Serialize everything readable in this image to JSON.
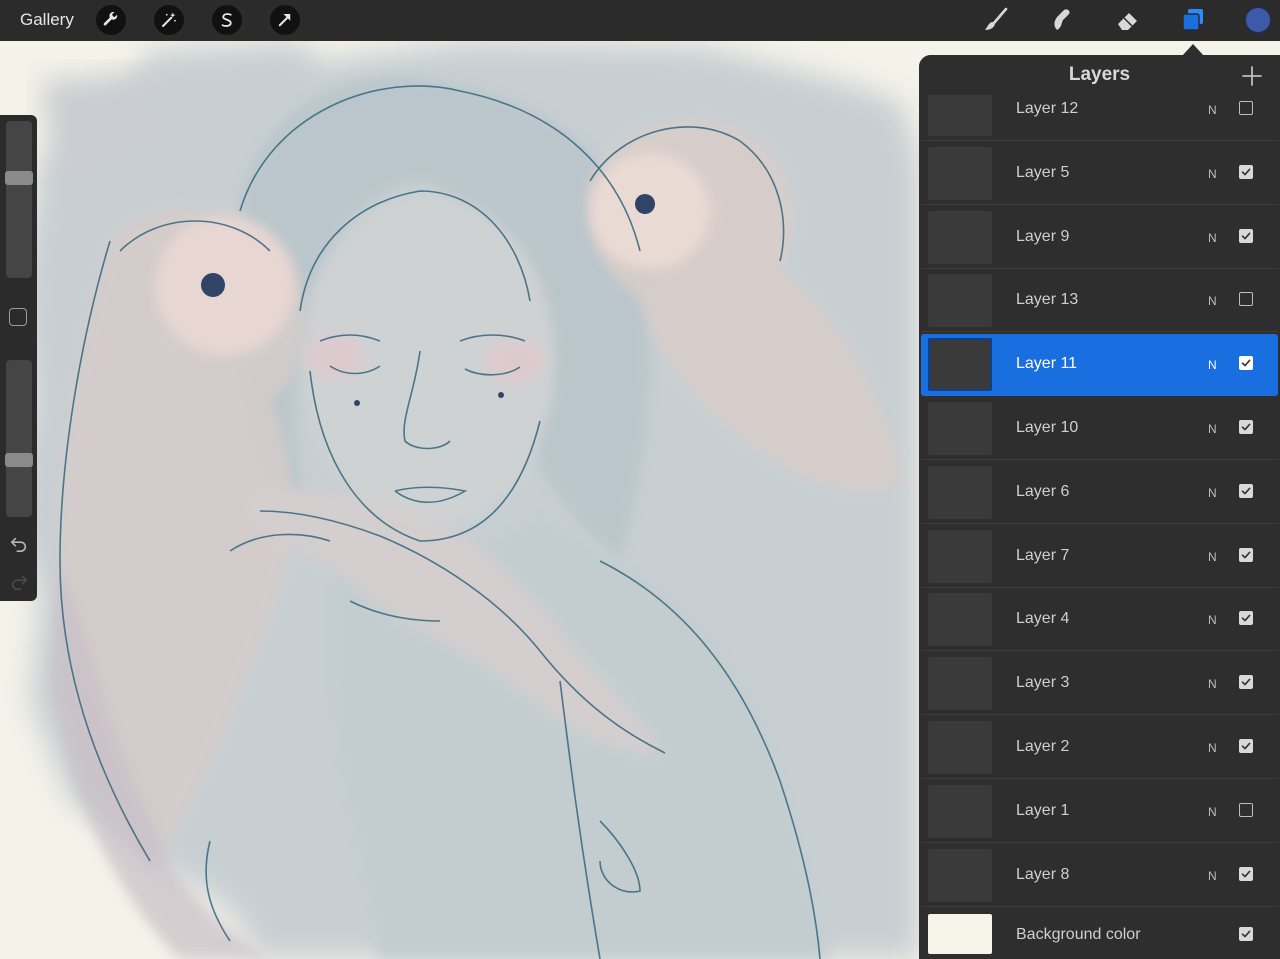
{
  "topbar": {
    "gallery_label": "Gallery",
    "left_tools": [
      {
        "icon": "wrench-icon",
        "name": "actions"
      },
      {
        "icon": "magic-wand-icon",
        "name": "adjustments"
      },
      {
        "icon": "selection-s-icon",
        "name": "selection"
      },
      {
        "icon": "transform-arrow-icon",
        "name": "transform"
      }
    ],
    "right_tools": [
      {
        "icon": "paintbrush-icon",
        "name": "brush"
      },
      {
        "icon": "smudge-icon",
        "name": "smudge"
      },
      {
        "icon": "eraser-icon",
        "name": "eraser"
      },
      {
        "icon": "layers-icon",
        "name": "layers",
        "active": true
      }
    ],
    "current_color": "#3d5aa8"
  },
  "sidebar": {
    "brush_size_level": 0.35,
    "opacity_level": 0.65
  },
  "layers_panel": {
    "title": "Layers",
    "accent_color": "#1a6fe0",
    "layers": [
      {
        "name": "Layer 12",
        "blend": "N",
        "visible": false,
        "active": false
      },
      {
        "name": "Layer 5",
        "blend": "N",
        "visible": true,
        "active": false
      },
      {
        "name": "Layer 9",
        "blend": "N",
        "visible": true,
        "active": false
      },
      {
        "name": "Layer 13",
        "blend": "N",
        "visible": false,
        "active": false
      },
      {
        "name": "Layer 11",
        "blend": "N",
        "visible": true,
        "active": true
      },
      {
        "name": "Layer 10",
        "blend": "N",
        "visible": true,
        "active": false
      },
      {
        "name": "Layer 6",
        "blend": "N",
        "visible": true,
        "active": false
      },
      {
        "name": "Layer 7",
        "blend": "N",
        "visible": true,
        "active": false
      },
      {
        "name": "Layer 4",
        "blend": "N",
        "visible": true,
        "active": false
      },
      {
        "name": "Layer 3",
        "blend": "N",
        "visible": true,
        "active": false
      },
      {
        "name": "Layer 2",
        "blend": "N",
        "visible": true,
        "active": false
      },
      {
        "name": "Layer 1",
        "blend": "N",
        "visible": false,
        "active": false
      },
      {
        "name": "Layer 8",
        "blend": "N",
        "visible": true,
        "active": false
      }
    ],
    "background": {
      "name": "Background color",
      "visible": true,
      "color": "#f6f3e8"
    }
  }
}
